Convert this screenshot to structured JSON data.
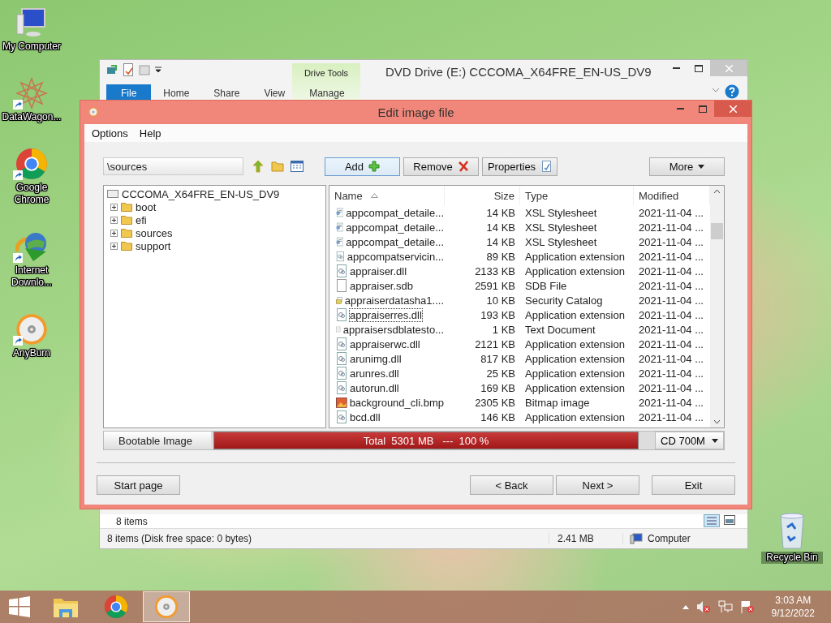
{
  "desktop_icons": [
    {
      "kind": "computer",
      "label": "My Computer",
      "shortcut": false
    },
    {
      "kind": "datawagon",
      "label": "DataWagon...",
      "shortcut": true
    },
    {
      "kind": "chrome",
      "label": "Google Chrome",
      "shortcut": true
    },
    {
      "kind": "idm",
      "label": "Internet Downlo...",
      "shortcut": true
    },
    {
      "kind": "anyburn",
      "label": "AnyBurn",
      "shortcut": true
    }
  ],
  "recycle_bin": {
    "label": "Recycle Bin"
  },
  "explorer": {
    "title": "DVD Drive (E:) CCCOMA_X64FRE_EN-US_DV9",
    "contextual_group": "Drive Tools",
    "ribbon_tabs": [
      {
        "label": "File",
        "selected": true
      },
      {
        "label": "Home",
        "selected": false
      },
      {
        "label": "Share",
        "selected": false
      },
      {
        "label": "View",
        "selected": false
      },
      {
        "label": "Manage",
        "selected": false
      }
    ],
    "content_status": "8 items",
    "status_bar": {
      "items": "8 items (Disk free space: 0 bytes)",
      "size": "2.41 MB",
      "location": "Computer"
    }
  },
  "dialog": {
    "title": "Edit image file",
    "menu": [
      "Options",
      "Help"
    ],
    "path": "\\sources",
    "actions": [
      {
        "kind": "add",
        "label": "Add"
      },
      {
        "kind": "remove",
        "label": "Remove"
      },
      {
        "kind": "properties",
        "label": "Properties"
      }
    ],
    "more": "More",
    "tree": {
      "label": "CCCOMA_X64FRE_EN-US_DV9",
      "children": [
        {
          "label": "boot",
          "expanded": false
        },
        {
          "label": "efi",
          "expanded": false
        },
        {
          "label": "sources",
          "expanded": false
        },
        {
          "label": "support",
          "expanded": false
        }
      ]
    },
    "columns": [
      {
        "label": "Name",
        "sorted": true
      },
      {
        "label": "Size",
        "sorted": false
      },
      {
        "label": "Type",
        "sorted": false
      },
      {
        "label": "Modified",
        "sorted": false
      }
    ],
    "rows": [
      {
        "kind": "xsl",
        "name": "appcompat_detaile...",
        "size": "14 KB",
        "type": "XSL Stylesheet",
        "modified": "2021-11-04 ...",
        "focused": false
      },
      {
        "kind": "xsl",
        "name": "appcompat_detaile...",
        "size": "14 KB",
        "type": "XSL Stylesheet",
        "modified": "2021-11-04 ...",
        "focused": false
      },
      {
        "kind": "xsl",
        "name": "appcompat_detaile...",
        "size": "14 KB",
        "type": "XSL Stylesheet",
        "modified": "2021-11-04 ...",
        "focused": false
      },
      {
        "kind": "dll",
        "name": "appcompatservicin...",
        "size": "89 KB",
        "type": "Application extension",
        "modified": "2021-11-04 ...",
        "focused": false
      },
      {
        "kind": "dll",
        "name": "appraiser.dll",
        "size": "2133 KB",
        "type": "Application extension",
        "modified": "2021-11-04 ...",
        "focused": false
      },
      {
        "kind": "blank",
        "name": "appraiser.sdb",
        "size": "2591 KB",
        "type": "SDB File",
        "modified": "2021-11-04 ...",
        "focused": false
      },
      {
        "kind": "catalog",
        "name": "appraiserdatasha1....",
        "size": "10 KB",
        "type": "Security Catalog",
        "modified": "2021-11-04 ...",
        "focused": false
      },
      {
        "kind": "dll",
        "name": "appraiserres.dll",
        "size": "193 KB",
        "type": "Application extension",
        "modified": "2021-11-04 ...",
        "focused": true
      },
      {
        "kind": "text",
        "name": "appraisersdblatesto...",
        "size": "1 KB",
        "type": "Text Document",
        "modified": "2021-11-04 ...",
        "focused": false
      },
      {
        "kind": "dll",
        "name": "appraiserwc.dll",
        "size": "2121 KB",
        "type": "Application extension",
        "modified": "2021-11-04 ...",
        "focused": false
      },
      {
        "kind": "dll",
        "name": "arunimg.dll",
        "size": "817 KB",
        "type": "Application extension",
        "modified": "2021-11-04 ...",
        "focused": false
      },
      {
        "kind": "dll",
        "name": "arunres.dll",
        "size": "25 KB",
        "type": "Application extension",
        "modified": "2021-11-04 ...",
        "focused": false
      },
      {
        "kind": "dll",
        "name": "autorun.dll",
        "size": "169 KB",
        "type": "Application extension",
        "modified": "2021-11-04 ...",
        "focused": false
      },
      {
        "kind": "bmp",
        "name": "background_cli.bmp",
        "size": "2305 KB",
        "type": "Bitmap image",
        "modified": "2021-11-04 ...",
        "focused": false
      },
      {
        "kind": "dll",
        "name": "bcd.dll",
        "size": "146 KB",
        "type": "Application extension",
        "modified": "2021-11-04 ...",
        "focused": false
      }
    ],
    "image_type": "Bootable Image",
    "usage": {
      "text": "Total  5301 MB   ---  100 %",
      "level": 1.0
    },
    "media": "CD 700M",
    "buttons": [
      {
        "kind": "start",
        "label": "Start page"
      },
      {
        "kind": "back",
        "label": "< Back"
      },
      {
        "kind": "next",
        "label": "Next >"
      },
      {
        "kind": "exit",
        "label": "Exit"
      }
    ]
  },
  "taskbar": {
    "apps": [
      {
        "kind": "explorer",
        "selected": false
      },
      {
        "kind": "chrome",
        "selected": false
      },
      {
        "kind": "anyburn",
        "selected": true
      }
    ],
    "time": "3:03 AM",
    "date": "9/12/2022"
  }
}
